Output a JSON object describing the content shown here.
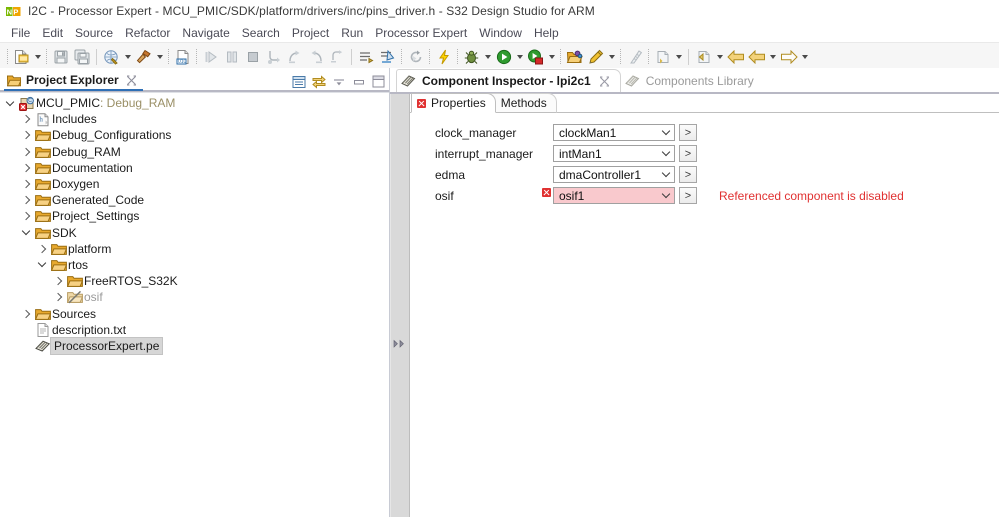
{
  "window": {
    "title": "I2C - Processor Expert - MCU_PMIC/SDK/platform/drivers/inc/pins_driver.h - S32 Design Studio for ARM",
    "app_icon": "nxp-logo-icon"
  },
  "menubar": {
    "items": [
      {
        "label": "File"
      },
      {
        "label": "Edit"
      },
      {
        "label": "Source"
      },
      {
        "label": "Refactor"
      },
      {
        "label": "Navigate"
      },
      {
        "label": "Search"
      },
      {
        "label": "Project"
      },
      {
        "label": "Run"
      },
      {
        "label": "Processor Expert"
      },
      {
        "label": "Window"
      },
      {
        "label": "Help"
      }
    ]
  },
  "toolbar": {
    "items": [
      {
        "icon": "new-file-icon",
        "dropdown": true
      },
      {
        "icon": "save-icon",
        "dropdown": false
      },
      {
        "icon": "save-all-icon",
        "dropdown": false
      },
      {
        "sep": "hard"
      },
      {
        "icon": "build-all-icon",
        "dropdown": true
      },
      {
        "icon": "build-hammer-icon",
        "dropdown": true
      },
      {
        "sep": "dot"
      },
      {
        "icon": "binary-file-icon",
        "dropdown": false
      },
      {
        "sep": "dot"
      },
      {
        "icon": "resume-icon",
        "dropdown": false
      },
      {
        "icon": "suspend-icon",
        "dropdown": false
      },
      {
        "icon": "terminate-icon",
        "dropdown": false
      },
      {
        "icon": "step-into-icon",
        "dropdown": false
      },
      {
        "icon": "step-over-icon",
        "dropdown": false
      },
      {
        "icon": "step-return-icon",
        "dropdown": false
      },
      {
        "icon": "step-instruction-icon",
        "dropdown": false
      },
      {
        "sep": "hard"
      },
      {
        "icon": "instruction-stepping-icon",
        "dropdown": false
      },
      {
        "icon": "disassembly-icon",
        "dropdown": false
      },
      {
        "sep": "dot"
      },
      {
        "icon": "restart-icon",
        "dropdown": false
      },
      {
        "sep": "dot"
      },
      {
        "icon": "flash-icon",
        "dropdown": false
      },
      {
        "sep": "dot"
      },
      {
        "icon": "debug-bug-icon",
        "dropdown": true
      },
      {
        "icon": "run-icon",
        "dropdown": true
      },
      {
        "icon": "run-external-icon",
        "dropdown": true
      },
      {
        "sep": "dot"
      },
      {
        "icon": "open-resource-icon",
        "dropdown": false
      },
      {
        "icon": "search-pencil-icon",
        "dropdown": true
      },
      {
        "sep": "dot"
      },
      {
        "icon": "ruler-icon",
        "dropdown": false
      },
      {
        "sep": "dot"
      },
      {
        "icon": "next-annotation-icon",
        "dropdown": true
      },
      {
        "sep": "hard"
      },
      {
        "icon": "previous-annotation-icon",
        "dropdown": true
      },
      {
        "icon": "back-icon",
        "dropdown": false
      },
      {
        "icon": "back-history-icon",
        "dropdown": true
      },
      {
        "icon": "forward-icon",
        "dropdown": true
      }
    ]
  },
  "project_explorer": {
    "tab_label": "Project Explorer",
    "tab_icon": "project-explorer-icon",
    "close_icon": "close-icon",
    "toolbar_icons": [
      {
        "name": "collapse-all-icon"
      },
      {
        "name": "link-with-editor-icon"
      },
      {
        "name": "view-menu-icon"
      },
      {
        "name": "minimize-view-icon"
      },
      {
        "name": "maximize-view-icon"
      }
    ],
    "tree": [
      {
        "label": "MCU_PMIC",
        "suffix": ": Debug_RAM",
        "indent": 0,
        "twisty": "expanded",
        "icon": "c-project-error-icon",
        "dim": false,
        "selected": false
      },
      {
        "label": "Includes",
        "suffix": "",
        "indent": 1,
        "twisty": "collapsed",
        "icon": "includes-icon",
        "dim": false,
        "selected": false
      },
      {
        "label": "Debug_Configurations",
        "suffix": "",
        "indent": 1,
        "twisty": "collapsed",
        "icon": "folder-icon",
        "dim": false,
        "selected": false
      },
      {
        "label": "Debug_RAM",
        "suffix": "",
        "indent": 1,
        "twisty": "collapsed",
        "icon": "folder-icon",
        "dim": false,
        "selected": false
      },
      {
        "label": "Documentation",
        "suffix": "",
        "indent": 1,
        "twisty": "collapsed",
        "icon": "folder-icon",
        "dim": false,
        "selected": false
      },
      {
        "label": "Doxygen",
        "suffix": "",
        "indent": 1,
        "twisty": "collapsed",
        "icon": "folder-icon",
        "dim": false,
        "selected": false
      },
      {
        "label": "Generated_Code",
        "suffix": "",
        "indent": 1,
        "twisty": "collapsed",
        "icon": "folder-icon",
        "dim": false,
        "selected": false
      },
      {
        "label": "Project_Settings",
        "suffix": "",
        "indent": 1,
        "twisty": "collapsed",
        "icon": "folder-icon",
        "dim": false,
        "selected": false
      },
      {
        "label": "SDK",
        "suffix": "",
        "indent": 1,
        "twisty": "expanded",
        "icon": "folder-icon",
        "dim": false,
        "selected": false
      },
      {
        "label": "platform",
        "suffix": "",
        "indent": 2,
        "twisty": "collapsed",
        "icon": "folder-icon",
        "dim": false,
        "selected": false
      },
      {
        "label": "rtos",
        "suffix": "",
        "indent": 2,
        "twisty": "expanded",
        "icon": "folder-icon",
        "dim": false,
        "selected": false
      },
      {
        "label": "FreeRTOS_S32K",
        "suffix": "",
        "indent": 3,
        "twisty": "collapsed",
        "icon": "folder-icon",
        "dim": false,
        "selected": false
      },
      {
        "label": "osif",
        "suffix": "",
        "indent": 3,
        "twisty": "collapsed",
        "icon": "folder-excluded-icon",
        "dim": true,
        "selected": false
      },
      {
        "label": "Sources",
        "suffix": "",
        "indent": 1,
        "twisty": "collapsed",
        "icon": "folder-icon",
        "dim": false,
        "selected": false
      },
      {
        "label": "description.txt",
        "suffix": "",
        "indent": 1,
        "twisty": "none",
        "icon": "text-file-icon",
        "dim": false,
        "selected": false
      },
      {
        "label": "ProcessorExpert.pe",
        "suffix": "",
        "indent": 1,
        "twisty": "none",
        "icon": "processor-expert-icon",
        "dim": false,
        "selected": true
      }
    ]
  },
  "component_inspector": {
    "tabs": [
      {
        "label": "Component Inspector - lpi2c1",
        "icon": "component-inspector-icon",
        "active": true,
        "closable": true
      },
      {
        "label": "Components Library",
        "icon": "components-library-icon",
        "active": false,
        "closable": false
      }
    ],
    "property_tabs": [
      {
        "label": "Properties",
        "active": true,
        "error": true
      },
      {
        "label": "Methods",
        "active": false,
        "error": false
      }
    ],
    "rail_icon": "expand-rail-icon",
    "rail_glyph": ">>",
    "go_button_label": ">",
    "properties": [
      {
        "name": "clock_manager",
        "value": "clockMan1",
        "error": false,
        "message": ""
      },
      {
        "name": "interrupt_manager",
        "value": "intMan1",
        "error": false,
        "message": ""
      },
      {
        "name": "edma",
        "value": "dmaController1",
        "error": false,
        "message": ""
      },
      {
        "name": "osif",
        "value": "osif1",
        "error": true,
        "message": "Referenced component is disabled"
      }
    ]
  },
  "colors": {
    "error_red": "#e03131",
    "error_field_bg": "#f9c9cd",
    "toolbar_bg": "#f6f6f6",
    "rail_bg": "#d9d9d9",
    "selection_bg": "#d6d6d6"
  }
}
